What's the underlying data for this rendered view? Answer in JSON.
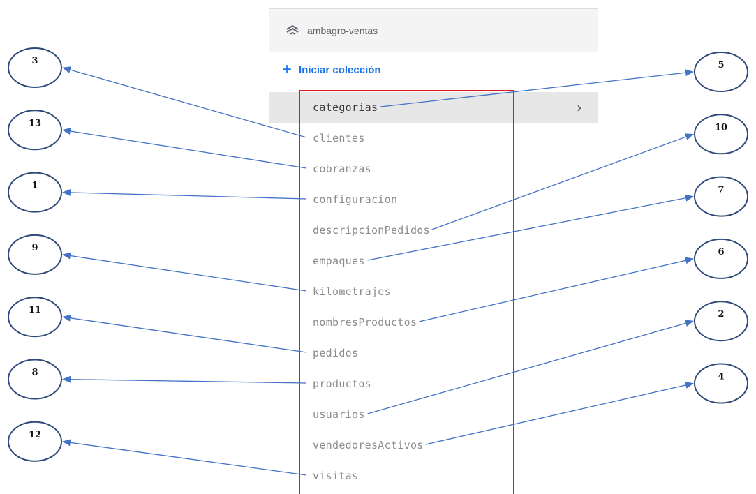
{
  "panel": {
    "db_icon": "database-stack-icon",
    "db_name": "ambagro-ventas",
    "start_icon": "plus-icon",
    "start_label": "Iniciar colección",
    "chevron_icon": "chevron-right-icon",
    "collections": [
      {
        "label": "categorias",
        "selected": true
      },
      {
        "label": "clientes"
      },
      {
        "label": "cobranzas"
      },
      {
        "label": "configuracion"
      },
      {
        "label": "descripcionPedidos"
      },
      {
        "label": "empaques"
      },
      {
        "label": "kilometrajes"
      },
      {
        "label": "nombresProductos"
      },
      {
        "label": "pedidos"
      },
      {
        "label": "productos"
      },
      {
        "label": "usuarios"
      },
      {
        "label": "vendedoresActivos"
      },
      {
        "label": "visitas"
      }
    ]
  },
  "annotations": {
    "highlight_color": "#e0191f",
    "arrow_color": "#4472c4",
    "circle_color": "#2f4a7a",
    "left_callouts": [
      {
        "number": "3",
        "target": "clientes"
      },
      {
        "number": "13",
        "target": "cobranzas"
      },
      {
        "number": "1",
        "target": "configuracion"
      },
      {
        "number": "9",
        "target": "kilometrajes"
      },
      {
        "number": "11",
        "target": "pedidos"
      },
      {
        "number": "8",
        "target": "productos"
      },
      {
        "number": "12",
        "target": "visitas"
      }
    ],
    "right_callouts": [
      {
        "number": "5",
        "target": "categorias"
      },
      {
        "number": "10",
        "target": "descripcionPedidos"
      },
      {
        "number": "7",
        "target": "empaques"
      },
      {
        "number": "6",
        "target": "nombresProductos"
      },
      {
        "number": "2",
        "target": "usuarios"
      },
      {
        "number": "4",
        "target": "vendedoresActivos"
      }
    ]
  }
}
